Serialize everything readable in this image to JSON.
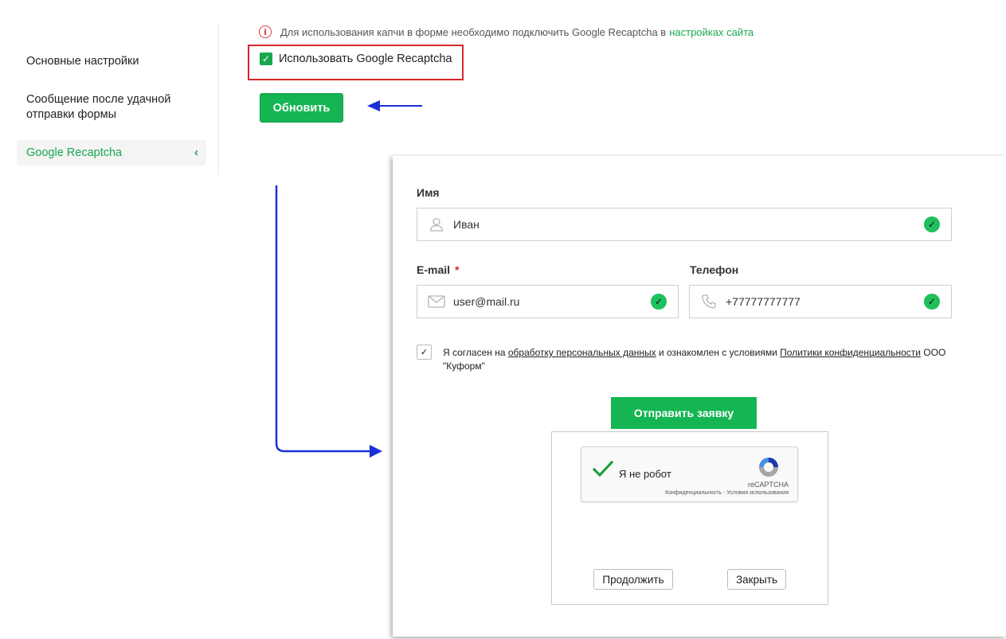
{
  "sidebar": {
    "items": [
      {
        "label": "Основные настройки"
      },
      {
        "label": "Сообщение после удачной отправки формы"
      },
      {
        "label": "Google Recaptcha",
        "active": true
      }
    ]
  },
  "settings": {
    "info_text": "Для использования капчи в форме необходимо подключить Google Recaptcha в",
    "info_link": "настройках сайта",
    "checkbox_label": "Использовать Google Recaptcha",
    "checkbox_checked": true,
    "update_button": "Обновить"
  },
  "form": {
    "name_label": "Имя",
    "name_value": "Иван",
    "email_label": "E-mail",
    "email_required_mark": "*",
    "email_value": "user@mail.ru",
    "phone_label": "Телефон",
    "phone_value": "+77777777777",
    "consent": {
      "checked": true,
      "text_1": "Я согласен на ",
      "link_1": "обработку персональных данных",
      "text_2": " и ознакомлен с условиями ",
      "link_2": "Политики конфиденциальности",
      "text_3": " ООО \"Куформ\""
    },
    "submit_button": "Отправить заявку"
  },
  "captcha": {
    "label": "Я не робот",
    "brand": "reCAPTCHA",
    "terms": "Конфиденциальность - Условия использования",
    "continue_button": "Продолжить",
    "close_button": "Закрыть"
  },
  "colors": {
    "accent_green": "#15b553",
    "highlight_red": "#d9262b",
    "arrow_blue": "#1a2fd6"
  }
}
